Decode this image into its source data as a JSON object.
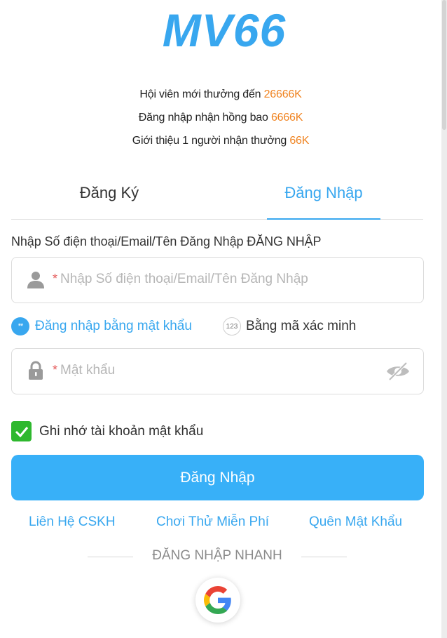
{
  "brand": {
    "logo_text": "MV66",
    "color": "#38a7ef"
  },
  "promos": [
    {
      "text": "Hội viên mới thưởng đến ",
      "amount": "26666K"
    },
    {
      "text": "Đăng nhập nhận hồng bao ",
      "amount": "6666K"
    },
    {
      "text": "Giới thiệu 1 người nhận thưởng ",
      "amount": "66K"
    }
  ],
  "tabs": {
    "register": "Đăng Ký",
    "login": "Đăng Nhập",
    "active": "login"
  },
  "form": {
    "account_label": "Nhập Số điện thoại/Email/Tên Đăng Nhập ĐĂNG NHẬP",
    "account_placeholder": "Nhập Số điện thoại/Email/Tên Đăng Nhập",
    "required_mark": "*",
    "mode_password": "Đăng nhập bằng mật khẩu",
    "mode_password_icon_text": "**",
    "mode_code": "Bằng mã xác minh",
    "mode_code_icon_text": "123",
    "password_placeholder": "Mật khẩu",
    "remember_label": "Ghi nhớ tài khoản mật khẩu",
    "remember_checked": true,
    "submit_label": "Đăng Nhập"
  },
  "links": {
    "support": "Liên Hệ CSKH",
    "trial": "Chơi Thử Miễn Phí",
    "forgot": "Quên Mật Khẩu"
  },
  "quick_login": {
    "label": "ĐĂNG NHẬP NHANH",
    "providers": [
      "google"
    ]
  },
  "icons": {
    "user": "user-icon",
    "lock": "lock-icon",
    "eye": "eye-off-icon",
    "check": "check-icon",
    "google": "google-icon"
  },
  "colors": {
    "accent": "#38a7ef",
    "button": "#38b0f8",
    "amount": "#f08320",
    "checkbox": "#2eb82e"
  }
}
